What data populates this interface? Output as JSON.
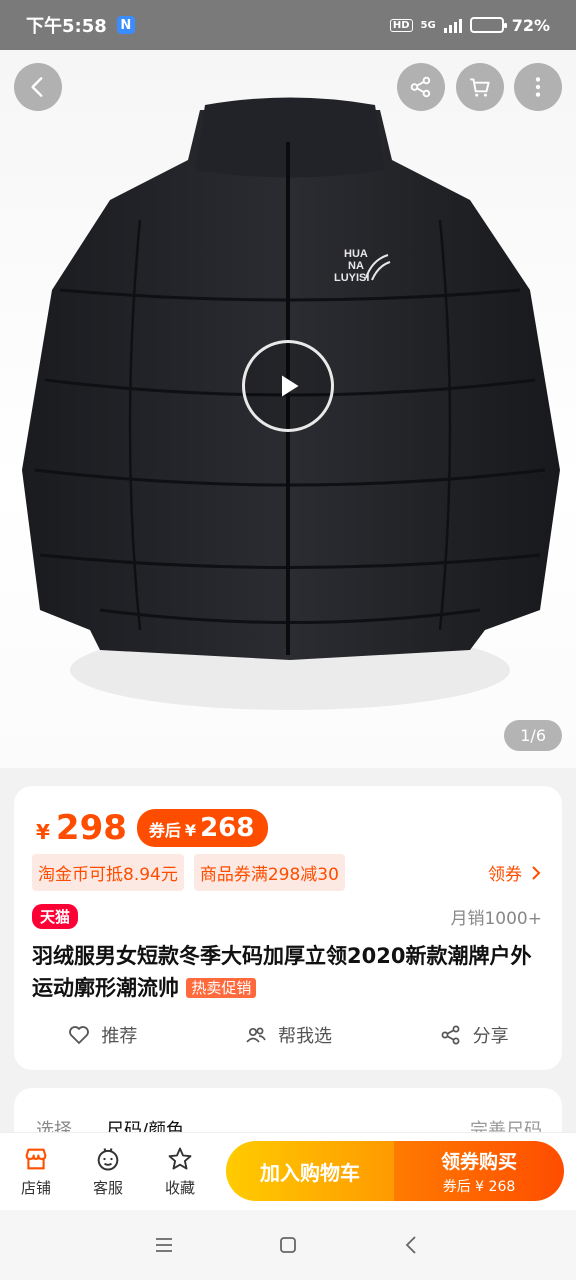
{
  "status": {
    "time": "下午5:58",
    "badge": "N",
    "hd": "HD",
    "network": "5G",
    "battery": "72%",
    "battery_level": 0.72
  },
  "gallery": {
    "counter": "1/6",
    "jacket_logo": [
      "HUA",
      "NA",
      "LUYISI"
    ]
  },
  "product": {
    "currency": "¥",
    "price": "298",
    "after_label": "券后",
    "after_currency": "¥",
    "after_price": "268",
    "chip_coins": "淘金币可抵8.94元",
    "chip_coupon": "商品券满298减30",
    "get_coupon": "领券",
    "store_tag": "天猫",
    "monthly_sales": "月销1000+",
    "title": "羽绒服男女短款冬季大码加厚立领2020新款潮牌户外运动廓形潮流帅",
    "promo_tag": "热卖促销"
  },
  "actions": {
    "recommend": "推荐",
    "help_choose": "帮我选",
    "share": "分享"
  },
  "select": {
    "label": "选择",
    "value": "尺码/颜色",
    "more": "完善尺码"
  },
  "bottom": {
    "shop": "店铺",
    "service": "客服",
    "favorite": "收藏",
    "add_cart": "加入购物车",
    "buy_label": "领券购买",
    "buy_sub": "券后 ¥ 268"
  },
  "colors": {
    "accent": "#ff4d00",
    "tmall": "#ff0036",
    "cart_start": "#ffcb00",
    "buy_end": "#ff4d00"
  }
}
